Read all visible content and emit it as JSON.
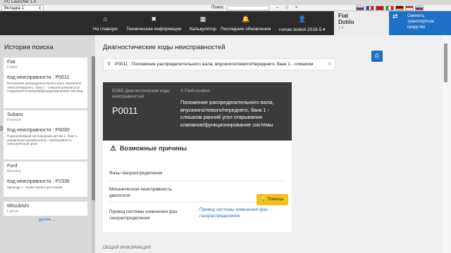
{
  "window": {
    "title": "PC Launcher 1.4"
  },
  "tabbar": {
    "tab_label": "Вкладка 1",
    "tab_close": "x",
    "search_label": "Поиск:",
    "window_controls": "–□×"
  },
  "nav": {
    "items": [
      {
        "icon": "home-icon",
        "glyph": "⌂",
        "label": "На главную"
      },
      {
        "icon": "wrench-icon",
        "glyph": "✖",
        "label": "Техническая информация"
      },
      {
        "icon": "calculator-icon",
        "glyph": "▦",
        "label": "Калькулятор"
      },
      {
        "icon": "bell-icon",
        "glyph": "🔔",
        "label": "Последние обновления"
      },
      {
        "icon": "user-icon",
        "glyph": "👤",
        "label": "roman.tenkof-2018-5 ▾"
      }
    ]
  },
  "flags": [
    "#1e4fa3",
    "#d22",
    "#c8102e",
    "#cf142b",
    "#fff",
    "#000",
    "#c22"
  ],
  "vehicle": {
    "make": "Fiat",
    "model": "Doblo",
    "version": "1.4"
  },
  "change_vehicle": {
    "label": "Сменить транспортное средство",
    "glyph": "⇄"
  },
  "sidebar": {
    "title": "История поиска",
    "more": "далее....",
    "cards": [
      {
        "make": "Fiat",
        "model": "Doblo",
        "code": "Код неисправности : P0011",
        "desc": "Положение распределительного вала, впускного/левого/переднего, банк 1 - слишком ранний угол открывания клапанов/функционирование системы"
      },
      {
        "make": "Subaru",
        "model": "Forester",
        "code": "Код неисправности : P0030",
        "desc": "Подогреваемый кислородный датчик 1, банк 1, управление нагревателем - неисправность электрической цепи"
      },
      {
        "make": "Ford",
        "model": "Mondeo",
        "code": "Код неисправности : P2336",
        "desc": "Цилиндр 1 - выше порога детонации"
      },
      {
        "make": "Mitsubishi",
        "model": "Lancer",
        "code": "",
        "desc": ""
      }
    ]
  },
  "main": {
    "title": "Диагностические коды неисправностей",
    "search_value": "P0011 : Положение распределительного вала, впускного/левого/переднего, банк 1 - слишком",
    "search_clear": "X",
    "code_box": {
      "standard": "EOBD Диагностические коды неисправностей",
      "code": "P0011",
      "fault_label": "Fault location",
      "fault_desc": "Положение распределительного вала, впускного/левого/переднего, банк 1 - слишком ранний угол открывания клапанов/функционирование системы"
    },
    "causes": {
      "title": "Возможные причины",
      "rows": [
        {
          "label": "Фазы газораспределения",
          "link": ""
        },
        {
          "label": "Механическая неисправность двигателя",
          "link": ""
        },
        {
          "label": "Привод системы изменения фаз газораспределения",
          "link": "Привод системы изменения фаз газораспределения"
        }
      ],
      "help_label": "Помощь"
    },
    "general_info": "ОБЩАЯ ИНФОРМАЦИЯ"
  }
}
